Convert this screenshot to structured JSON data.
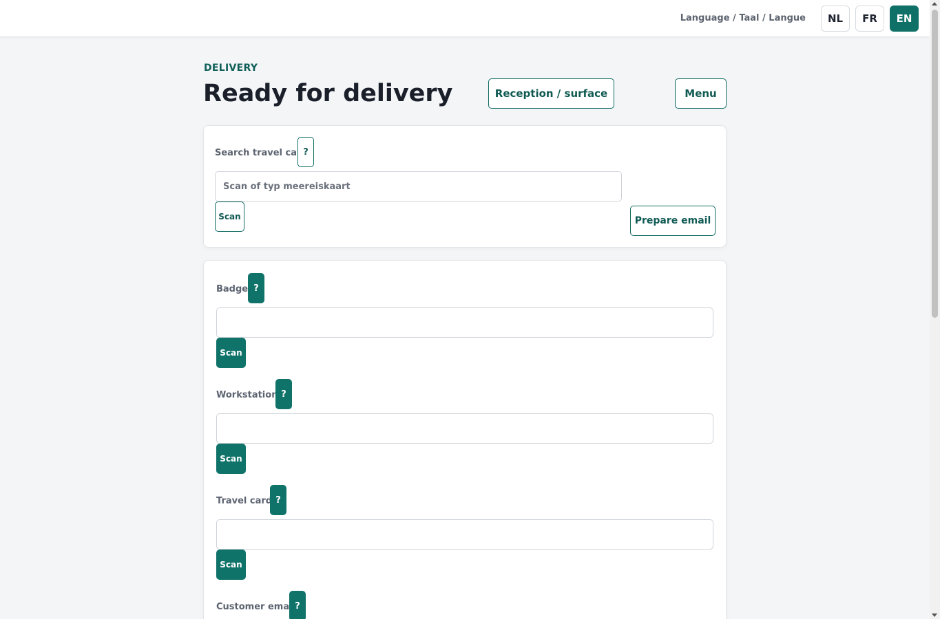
{
  "header": {
    "language_label": "Language / Taal / Langue",
    "languages": [
      "NL",
      "FR",
      "EN"
    ],
    "active_language": "EN"
  },
  "page": {
    "eyebrow": "DELIVERY",
    "title": "Ready for delivery",
    "reception_button": "Reception / surface",
    "menu_button": "Menu"
  },
  "search": {
    "label": "Search travel card",
    "help": "?",
    "placeholder": "Scan of typ meereiskaart",
    "scan_button": "Scan",
    "prepare_email_button": "Prepare email"
  },
  "form": {
    "fields": [
      {
        "label": "Badge",
        "help": "?",
        "value": "",
        "scan": "Scan"
      },
      {
        "label": "Workstation",
        "help": "?",
        "value": "",
        "scan": "Scan"
      },
      {
        "label": "Travel card",
        "help": "?",
        "value": "",
        "scan": "Scan"
      },
      {
        "label": "Customer email",
        "help": "?"
      }
    ]
  },
  "colors": {
    "accent": "#10736a",
    "accent_text": "#0f5a53",
    "background": "#f3f5f7"
  }
}
